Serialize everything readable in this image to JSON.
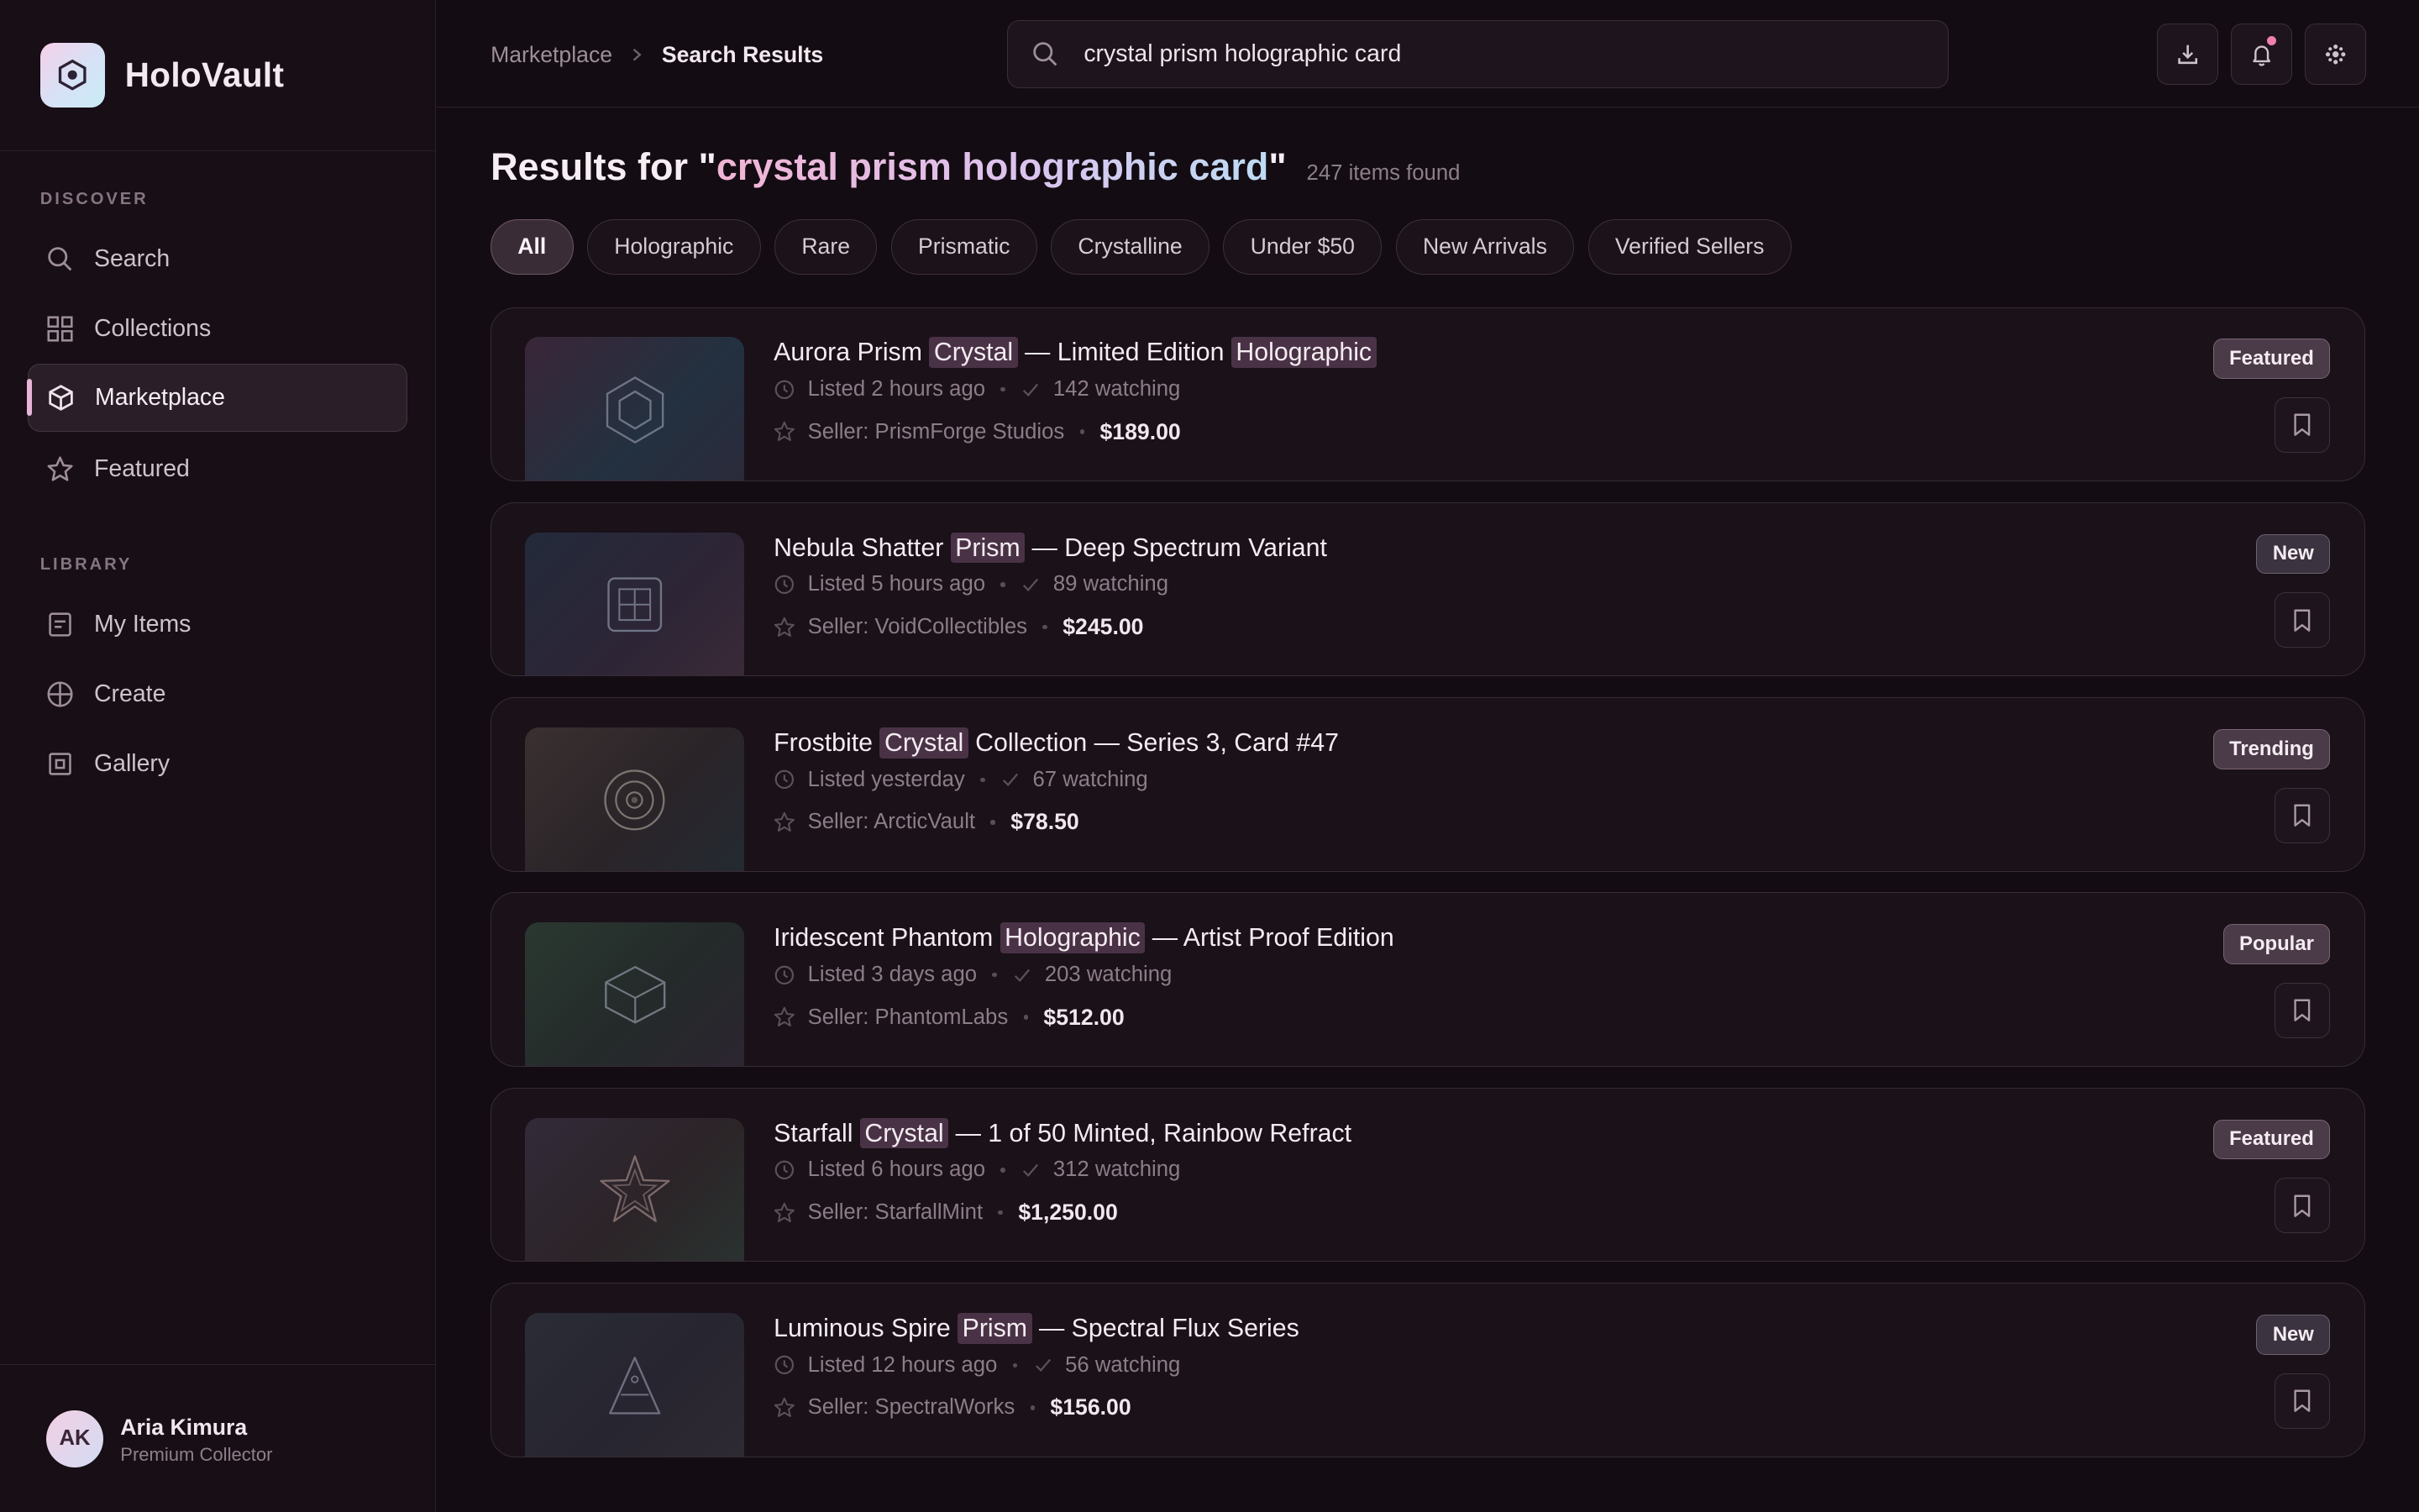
{
  "app": {
    "name": "HoloVault"
  },
  "sidebar": {
    "discover_label": "DISCOVER",
    "library_label": "LIBRARY",
    "discover_items": [
      {
        "label": "Search",
        "icon": "search-icon"
      },
      {
        "label": "Collections",
        "icon": "grid-icon"
      },
      {
        "label": "Marketplace",
        "icon": "cube-icon",
        "active": true
      },
      {
        "label": "Featured",
        "icon": "star-icon"
      }
    ],
    "library_items": [
      {
        "label": "My Items",
        "icon": "document-icon"
      },
      {
        "label": "Create",
        "icon": "plus-circle-icon"
      },
      {
        "label": "Gallery",
        "icon": "image-icon"
      }
    ],
    "user": {
      "initials": "AK",
      "name": "Aria Kimura",
      "role": "Premium Collector"
    }
  },
  "topbar": {
    "breadcrumb": {
      "root": "Marketplace",
      "current": "Search Results"
    },
    "search": {
      "value": "crystal prism holographic card"
    }
  },
  "main": {
    "heading": {
      "prefix": "Results for \"",
      "query": "crystal prism holographic card",
      "suffix": "\"",
      "count": "247 items found"
    },
    "filters": [
      "All",
      "Holographic",
      "Rare",
      "Prismatic",
      "Crystalline",
      "Under $50",
      "New Arrivals",
      "Verified Sellers"
    ],
    "active_filter": "All",
    "results": [
      {
        "title_pre": "Aurora Prism ",
        "hl1": "Crystal",
        "title_mid": " — Limited Edition ",
        "hl2": "Holographic",
        "title_post": "",
        "listed": "Listed 2 hours ago",
        "watching": "142 watching",
        "seller": "Seller: PrismForge Studios",
        "price": "$189.00",
        "badge": "Featured",
        "thumb_icon": "hexagon-icon"
      },
      {
        "title_pre": "Nebula Shatter ",
        "hl1": "Prism",
        "title_mid": " — Deep Spectrum Variant",
        "hl2": "",
        "title_post": "",
        "listed": "Listed 5 hours ago",
        "watching": "89 watching",
        "seller": "Seller: VoidCollectibles",
        "price": "$245.00",
        "badge": "New",
        "thumb_icon": "square-grid-icon"
      },
      {
        "title_pre": "Frostbite ",
        "hl1": "Crystal",
        "title_mid": " Collection — Series 3, Card #47",
        "hl2": "",
        "title_post": "",
        "listed": "Listed yesterday",
        "watching": "67 watching",
        "seller": "Seller: ArcticVault",
        "price": "$78.50",
        "badge": "Trending",
        "thumb_icon": "concentric-circles-icon"
      },
      {
        "title_pre": "Iridescent Phantom ",
        "hl1": "Holographic",
        "title_mid": " — Artist Proof Edition",
        "hl2": "",
        "title_post": "",
        "listed": "Listed 3 days ago",
        "watching": "203 watching",
        "seller": "Seller: PhantomLabs",
        "price": "$512.00",
        "badge": "Popular",
        "thumb_icon": "box-icon"
      },
      {
        "title_pre": "Starfall ",
        "hl1": "Crystal",
        "title_mid": " — 1 of 50 Minted, Rainbow Refract",
        "hl2": "",
        "title_post": "",
        "listed": "Listed 6 hours ago",
        "watching": "312 watching",
        "seller": "Seller: StarfallMint",
        "price": "$1,250.00",
        "badge": "Featured",
        "thumb_icon": "star-outline-icon"
      },
      {
        "title_pre": "Luminous Spire ",
        "hl1": "Prism",
        "title_mid": " — Spectral Flux Series",
        "hl2": "",
        "title_post": "",
        "listed": "Listed 12 hours ago",
        "watching": "56 watching",
        "seller": "Seller: SpectralWorks",
        "price": "$156.00",
        "badge": "New",
        "thumb_icon": "triangle-icon"
      }
    ]
  },
  "colors": {
    "background": "#140c13",
    "accent": "#e7b5d5",
    "query_gradient_start": "#f1b4d4",
    "query_gradient_end": "#bddcf3",
    "highlight": "#4a3246"
  }
}
